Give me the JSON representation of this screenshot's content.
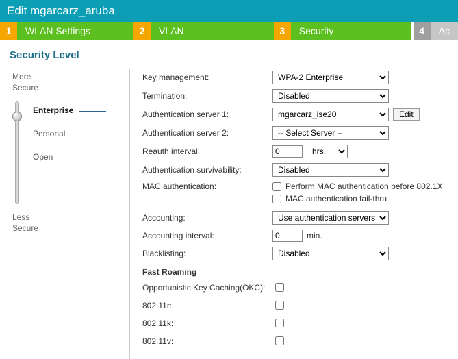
{
  "title": "Edit mgarcarz_aruba",
  "tabs": [
    {
      "num": "1",
      "label": "WLAN Settings"
    },
    {
      "num": "2",
      "label": "VLAN"
    },
    {
      "num": "3",
      "label": "Security"
    },
    {
      "num": "4",
      "label": "Ac"
    }
  ],
  "heading": "Security Level",
  "left": {
    "more": "More",
    "secure": "Secure",
    "less": "Less",
    "secure2": "Secure",
    "levels": {
      "enterprise": "Enterprise",
      "personal": "Personal",
      "open": "Open"
    }
  },
  "form": {
    "key_mgmt": {
      "label": "Key management:",
      "value": "WPA-2 Enterprise"
    },
    "termination": {
      "label": "Termination:",
      "value": "Disabled"
    },
    "auth1": {
      "label": "Authentication server 1:",
      "value": "mgarcarz_ise20",
      "edit": "Edit"
    },
    "auth2": {
      "label": "Authentication server 2:",
      "value": "-- Select Server --"
    },
    "reauth": {
      "label": "Reauth interval:",
      "value": "0",
      "unit": "hrs."
    },
    "surv": {
      "label": "Authentication survivability:",
      "value": "Disabled"
    },
    "mac": {
      "label": "MAC authentication:",
      "c1": "Perform MAC authentication before 802.1X",
      "c2": "MAC authentication fail-thru"
    },
    "acct": {
      "label": "Accounting:",
      "value": "Use authentication servers"
    },
    "acct_int": {
      "label": "Accounting interval:",
      "value": "0",
      "unit": "min."
    },
    "blacklist": {
      "label": "Blacklisting:",
      "value": "Disabled"
    },
    "roam": {
      "heading": "Fast Roaming",
      "okc": "Opportunistic Key Caching(OKC):",
      "r": "802.11r:",
      "k": "802.11k:",
      "v": "802.11v:"
    }
  }
}
